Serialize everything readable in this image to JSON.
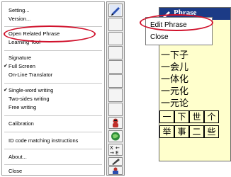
{
  "context_menu": {
    "items": [
      {
        "label": "Setting...",
        "checked": false
      },
      {
        "label": "Version...",
        "checked": false
      },
      {
        "label": "Open Related Phrase",
        "checked": false,
        "highlighted": true
      },
      {
        "label": "Learning Tool",
        "checked": false
      },
      {
        "label": "Signature",
        "checked": false
      },
      {
        "label": "Full Screen",
        "checked": true
      },
      {
        "label": "On-Line Translator",
        "checked": false
      },
      {
        "label": "Single-word writing",
        "checked": true
      },
      {
        "label": "Two-sides writing",
        "checked": false
      },
      {
        "label": "Free writing",
        "checked": false
      },
      {
        "label": "Calibration",
        "checked": false
      },
      {
        "label": "ID code matching instructions",
        "checked": false
      },
      {
        "label": "About...",
        "checked": false
      },
      {
        "label": "Close",
        "checked": false
      }
    ]
  },
  "toolbar": {
    "icons": [
      "pen-pointer-icon",
      "blank-button",
      "blank-button",
      "blank-button",
      "blank-button",
      "blank-button",
      "blank-button",
      "blank-button",
      "person-icon",
      "globe-icon",
      "swap-arrows-icon",
      "pen-icon",
      "teacher-icon"
    ]
  },
  "phrase_window": {
    "title": "Phrase",
    "phrases": [
      "一下子",
      "一会儿",
      "一体化",
      "一元化",
      "一元论"
    ],
    "grid_row_1": [
      "一",
      "下",
      "世",
      "个"
    ],
    "grid_row_2": [
      "举",
      "事",
      "二",
      "些"
    ]
  },
  "popup_menu": {
    "items": [
      "Edit Phrase",
      "Close"
    ]
  },
  "colors": {
    "annotation": "#d0112b",
    "title_bar": "#1c3b86",
    "phrase_bg": "#ffffcc"
  }
}
